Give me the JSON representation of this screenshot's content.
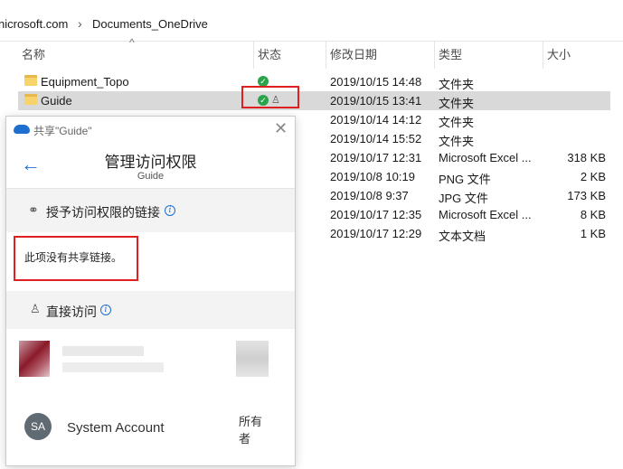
{
  "breadcrumb": {
    "segments": [
      "nicrosoft.com",
      "Documents_OneDrive"
    ],
    "separator": "›"
  },
  "columns": {
    "name": "名称",
    "status": "状态",
    "modified": "修改日期",
    "type": "类型",
    "size": "大小"
  },
  "files": [
    {
      "name": "Equipment_Topo",
      "status": "synced",
      "modified": "2019/10/15 14:48",
      "type": "文件夹",
      "size": ""
    },
    {
      "name": "Guide",
      "status": "synced-shared",
      "modified": "2019/10/15 13:41",
      "type": "文件夹",
      "size": ""
    },
    {
      "name": "",
      "status": "",
      "modified": "2019/10/14 14:12",
      "type": "文件夹",
      "size": ""
    },
    {
      "name": "",
      "status": "",
      "modified": "2019/10/14 15:52",
      "type": "文件夹",
      "size": ""
    },
    {
      "name": "",
      "status": "",
      "modified": "2019/10/17 12:31",
      "type": "Microsoft Excel ...",
      "size": "318 KB"
    },
    {
      "name": "",
      "status": "",
      "modified": "2019/10/8 10:19",
      "type": "PNG 文件",
      "size": "2 KB"
    },
    {
      "name": "",
      "status": "",
      "modified": "2019/10/8 9:37",
      "type": "JPG 文件",
      "size": "173 KB"
    },
    {
      "name": "",
      "status": "",
      "modified": "2019/10/17 12:35",
      "type": "Microsoft Excel ...",
      "size": "8 KB"
    },
    {
      "name": "",
      "status": "",
      "modified": "2019/10/17 12:29",
      "type": "文本文档",
      "size": "1 KB"
    }
  ],
  "share_panel": {
    "window_title": "共享\"Guide\"",
    "heading": "管理访问权限",
    "subheading": "Guide",
    "links_section_label": "授予访问权限的链接",
    "no_links_text": "此项没有共享链接。",
    "direct_access_label": "直接访问",
    "account": {
      "initials": "SA",
      "name": "System Account",
      "role": "所有者"
    }
  },
  "colors": {
    "accent": "#1f6fd1",
    "highlight": "#e02020",
    "selected_row": "#d9d9d9",
    "sync_ok": "#2aa44a"
  },
  "icons": {
    "back": "back-arrow-icon",
    "close": "close-icon",
    "cloud": "onedrive-cloud-icon",
    "link": "link-icon",
    "info": "info-icon",
    "person": "person-icon",
    "folder": "folder-icon"
  }
}
